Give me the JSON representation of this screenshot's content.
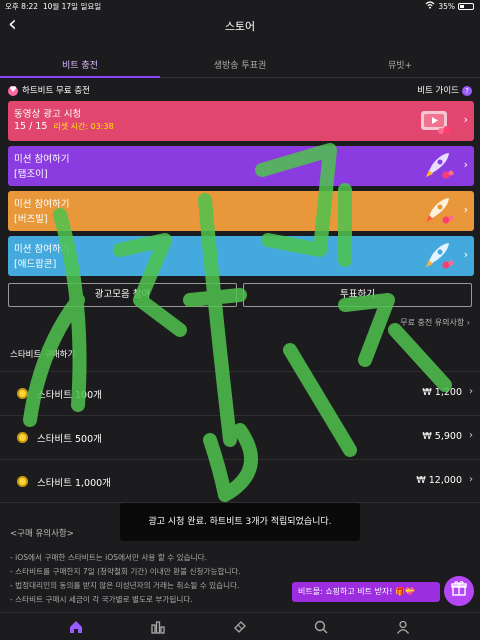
{
  "status": {
    "time": "오후 8:22",
    "date": "10월 17일 일요일",
    "battery": "35%"
  },
  "nav": {
    "title": "스토어"
  },
  "tabs": [
    {
      "label": "비트 충전",
      "active": true
    },
    {
      "label": "생방송 투표권",
      "active": false
    },
    {
      "label": "뮤빗+",
      "active": false
    }
  ],
  "free_section": {
    "title": "하트비트 무료 충전",
    "guide_label": "비트 가이드",
    "guide_icon": "?"
  },
  "cards": [
    {
      "line1": "동영상 광고 시청",
      "line2": "15 / 15",
      "timer": "리셋 시간: 03:38",
      "color": "#e1466f",
      "icon": "video-ad-icon"
    },
    {
      "line1": "미션 참여하기",
      "line2": "[탭조이]",
      "color": "#8a3ce0",
      "icon": "rocket-icon"
    },
    {
      "line1": "미션 참여하기",
      "line2": "[버즈빌]",
      "color": "#e8983a",
      "icon": "rocket-icon"
    },
    {
      "line1": "미션 참여하기",
      "line2": "[애드팝콘]",
      "color": "#44a9dc",
      "icon": "rocket-icon"
    }
  ],
  "buttons": {
    "ad_collection": "광고모음 참여",
    "vote": "투표하기"
  },
  "notes_link": "무료 충전 유의사항",
  "purchase": {
    "title": "스타비트 구매하기",
    "items": [
      {
        "name": "스타비트 100개",
        "price": "₩ 1,200"
      },
      {
        "name": "스타비트 500개",
        "price": "₩ 5,900"
      },
      {
        "name": "스타비트 1,000개",
        "price": "₩ 12,000"
      }
    ]
  },
  "caution": {
    "title": "<구매 유의사항>",
    "items": [
      "- iOS에서 구매한 스타비트는 iOS에서만 사용 할 수 있습니다.",
      "- 스타비트를 구매한지 7일 (청약철회 기간) 이내만 환불 신청가능합니다.",
      "- 법정대리인의 동의를 받지 않은 미성년자의 거래는 취소될 수 있습니다.",
      "- 스타비트 구매시 세금이 각 국가별로 별도로 부가됩니다."
    ]
  },
  "toast": "광고 시청 완료. 하트비트 3개가 적립되었습니다.",
  "promo": "비트몰: 쇼핑하고 비트 받자! 🎁💝",
  "bottom_nav": [
    "home-icon",
    "chart-icon",
    "ticket-icon",
    "search-icon",
    "profile-icon"
  ],
  "colors": {
    "accent": "#8b45ff",
    "background": "#1c1c1e",
    "watermark": "#4fc34f"
  }
}
